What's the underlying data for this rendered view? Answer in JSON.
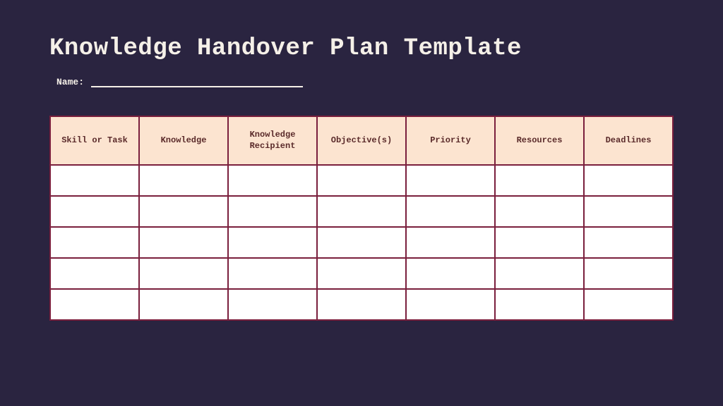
{
  "title": "Knowledge Handover Plan Template",
  "name_label": "Name:",
  "table": {
    "headers": [
      "Skill or Task",
      "Knowledge",
      "Knowledge Recipient",
      "Objective(s)",
      "Priority",
      "Resources",
      "Deadlines"
    ],
    "rows": [
      [
        "",
        "",
        "",
        "",
        "",
        "",
        ""
      ],
      [
        "",
        "",
        "",
        "",
        "",
        "",
        ""
      ],
      [
        "",
        "",
        "",
        "",
        "",
        "",
        ""
      ],
      [
        "",
        "",
        "",
        "",
        "",
        "",
        ""
      ],
      [
        "",
        "",
        "",
        "",
        "",
        "",
        ""
      ]
    ]
  }
}
